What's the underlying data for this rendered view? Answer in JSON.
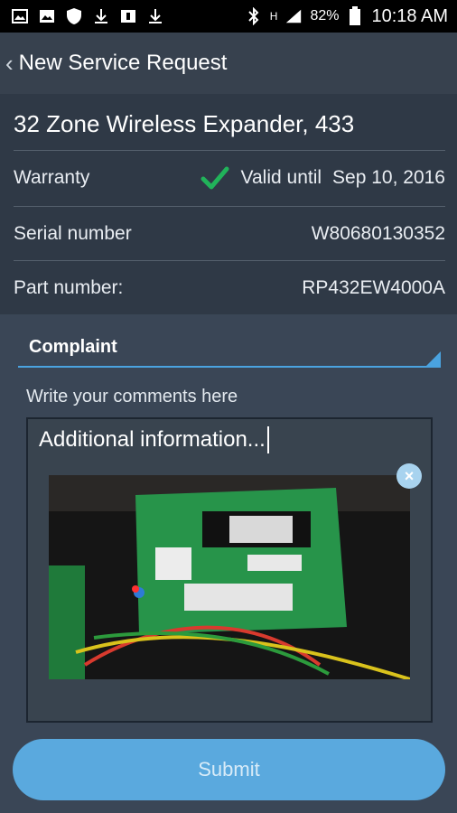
{
  "status_bar": {
    "battery": "82%",
    "time": "10:18 AM",
    "network": "H"
  },
  "header": {
    "title": "New Service Request"
  },
  "product": {
    "name": "32 Zone Wireless Expander, 433",
    "warranty_label": "Warranty",
    "warranty_status": "Valid until",
    "warranty_date": "Sep 10, 2016",
    "serial_label": "Serial number",
    "serial_value": "W80680130352",
    "part_label": "Part number:",
    "part_value": "RP432EW4000A"
  },
  "form": {
    "complaint_label": "Complaint",
    "comments_label": "Write your comments here",
    "comments_text": "Additional information...",
    "submit_label": "Submit"
  },
  "colors": {
    "accent": "#4aa3e0",
    "check": "#21b35a",
    "submit": "#5aa9de"
  }
}
